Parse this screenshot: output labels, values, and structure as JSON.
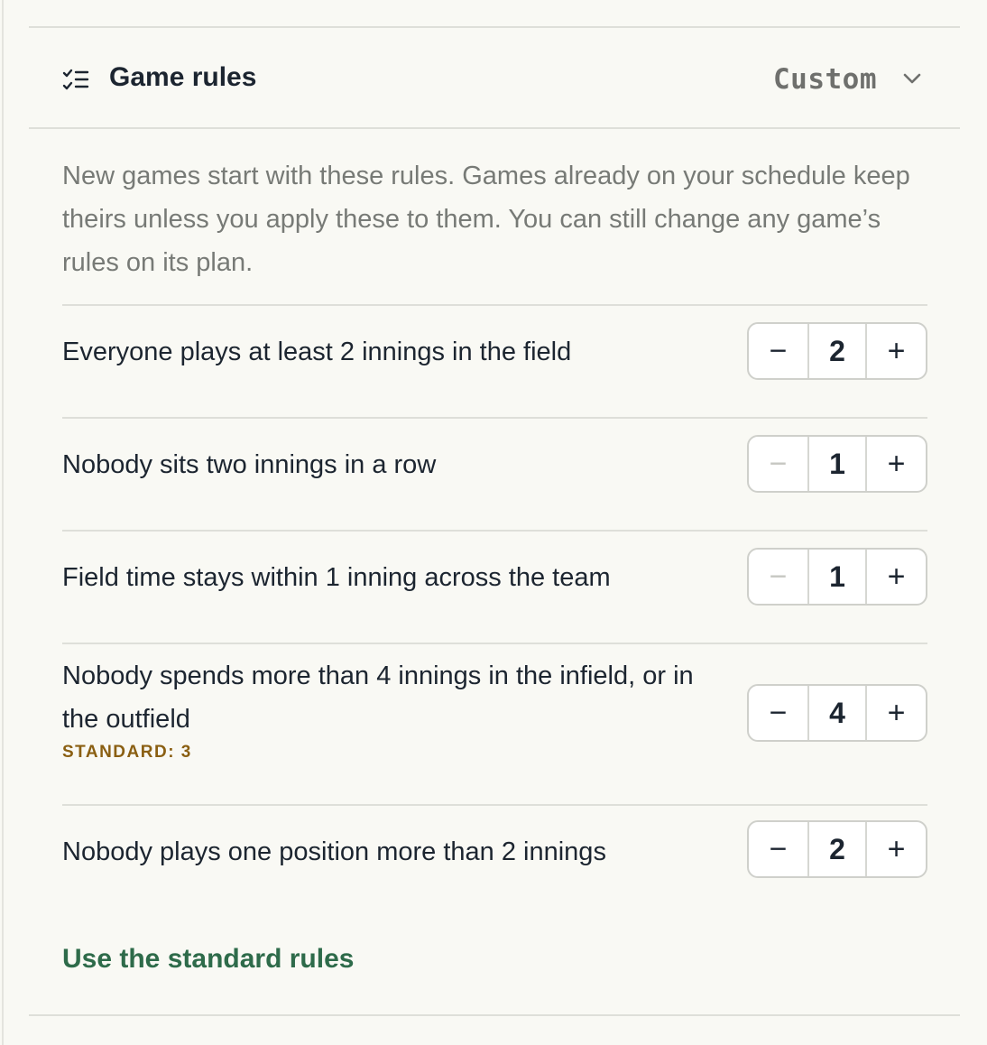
{
  "header": {
    "title": "Game rules",
    "preset_value": "Custom",
    "icon": "checklist-icon",
    "dropdown_icon": "chevron-down-icon"
  },
  "description": "New games start with these rules. Games already on your schedule keep theirs unless you apply these to them. You can still change any game’s rules on its plan.",
  "rules": [
    {
      "label": "Everyone plays at least 2 innings in the field",
      "value": "2",
      "minus_enabled": true,
      "plus_enabled": true
    },
    {
      "label": "Nobody sits two innings in a row",
      "value": "1",
      "minus_enabled": false,
      "plus_enabled": true
    },
    {
      "label": "Field time stays within 1 inning across the team",
      "value": "1",
      "minus_enabled": false,
      "plus_enabled": true
    },
    {
      "label": "Nobody spends more than 4 innings in the infield, or in the outfield",
      "value": "4",
      "standard_note": "STANDARD: 3",
      "minus_enabled": true,
      "plus_enabled": true
    },
    {
      "label": "Nobody plays one position more than 2 innings",
      "value": "2",
      "minus_enabled": true,
      "plus_enabled": true
    }
  ],
  "stepper": {
    "minus_label": "−",
    "plus_label": "+"
  },
  "reset_link": "Use the standard rules",
  "colors": {
    "background": "#f9f9f4",
    "text": "#1c2530",
    "muted": "#777a76",
    "accent_link": "#2e6b4a",
    "note": "#8a5f12"
  }
}
